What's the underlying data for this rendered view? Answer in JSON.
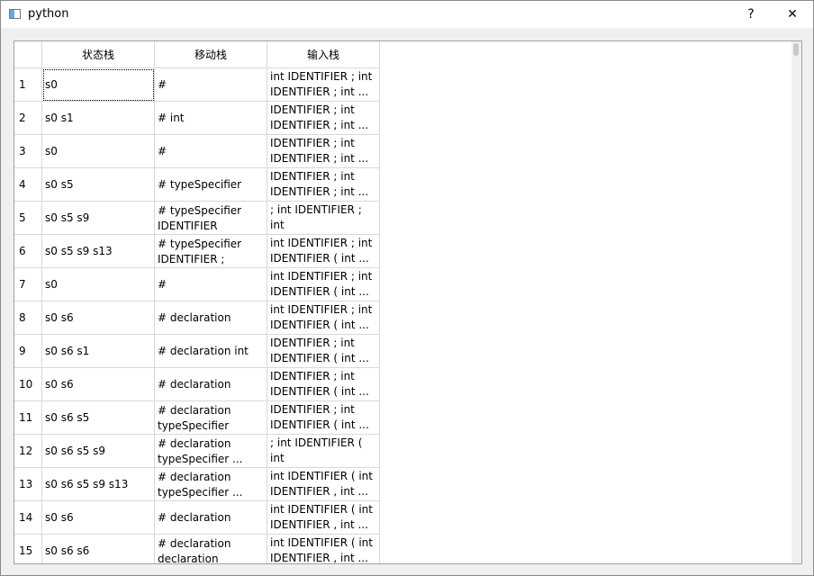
{
  "window": {
    "title": "python",
    "help_label": "?",
    "close_label": "✕"
  },
  "table": {
    "headers": [
      "状态栈",
      "移动栈",
      "输入栈"
    ],
    "rows": [
      {
        "num": "1",
        "state": "s0",
        "move": "#",
        "input": "int IDENTIFIER ; int\nIDENTIFIER ; int ..."
      },
      {
        "num": "2",
        "state": "s0 s1",
        "move": "# int",
        "input": "IDENTIFIER ; int\nIDENTIFIER ; int ..."
      },
      {
        "num": "3",
        "state": "s0",
        "move": "#",
        "input": "IDENTIFIER ; int\nIDENTIFIER ; int ..."
      },
      {
        "num": "4",
        "state": "s0 s5",
        "move": "# typeSpecifier",
        "input": "IDENTIFIER ; int\nIDENTIFIER ; int ..."
      },
      {
        "num": "5",
        "state": "s0 s5 s9",
        "move": "# typeSpecifier\nIDENTIFIER",
        "input": "; int IDENTIFIER ; int\nIDENTIFIER ( int ..."
      },
      {
        "num": "6",
        "state": "s0 s5 s9 s13",
        "move": "# typeSpecifier\nIDENTIFIER ;",
        "input": "int IDENTIFIER ; int\nIDENTIFIER ( int ..."
      },
      {
        "num": "7",
        "state": "s0",
        "move": "#",
        "input": "int IDENTIFIER ; int\nIDENTIFIER ( int ..."
      },
      {
        "num": "8",
        "state": "s0 s6",
        "move": "# declaration",
        "input": "int IDENTIFIER ; int\nIDENTIFIER ( int ..."
      },
      {
        "num": "9",
        "state": "s0 s6 s1",
        "move": "# declaration int",
        "input": "IDENTIFIER ; int\nIDENTIFIER ( int ..."
      },
      {
        "num": "10",
        "state": "s0 s6",
        "move": "# declaration",
        "input": "IDENTIFIER ; int\nIDENTIFIER ( int ..."
      },
      {
        "num": "11",
        "state": "s0 s6 s5",
        "move": "# declaration\ntypeSpecifier",
        "input": "IDENTIFIER ; int\nIDENTIFIER ( int ..."
      },
      {
        "num": "12",
        "state": "s0 s6 s5 s9",
        "move": "# declaration\ntypeSpecifier ...",
        "input": "; int IDENTIFIER ( int\nIDENTIFIER , int ..."
      },
      {
        "num": "13",
        "state": "s0 s6 s5 s9 s13",
        "move": "# declaration\ntypeSpecifier ...",
        "input": "int IDENTIFIER ( int\nIDENTIFIER , int ..."
      },
      {
        "num": "14",
        "state": "s0 s6",
        "move": "# declaration",
        "input": "int IDENTIFIER ( int\nIDENTIFIER , int ..."
      },
      {
        "num": "15",
        "state": "s0 s6 s6",
        "move": "# declaration\ndeclaration",
        "input": "int IDENTIFIER ( int\nIDENTIFIER , int ..."
      }
    ]
  }
}
